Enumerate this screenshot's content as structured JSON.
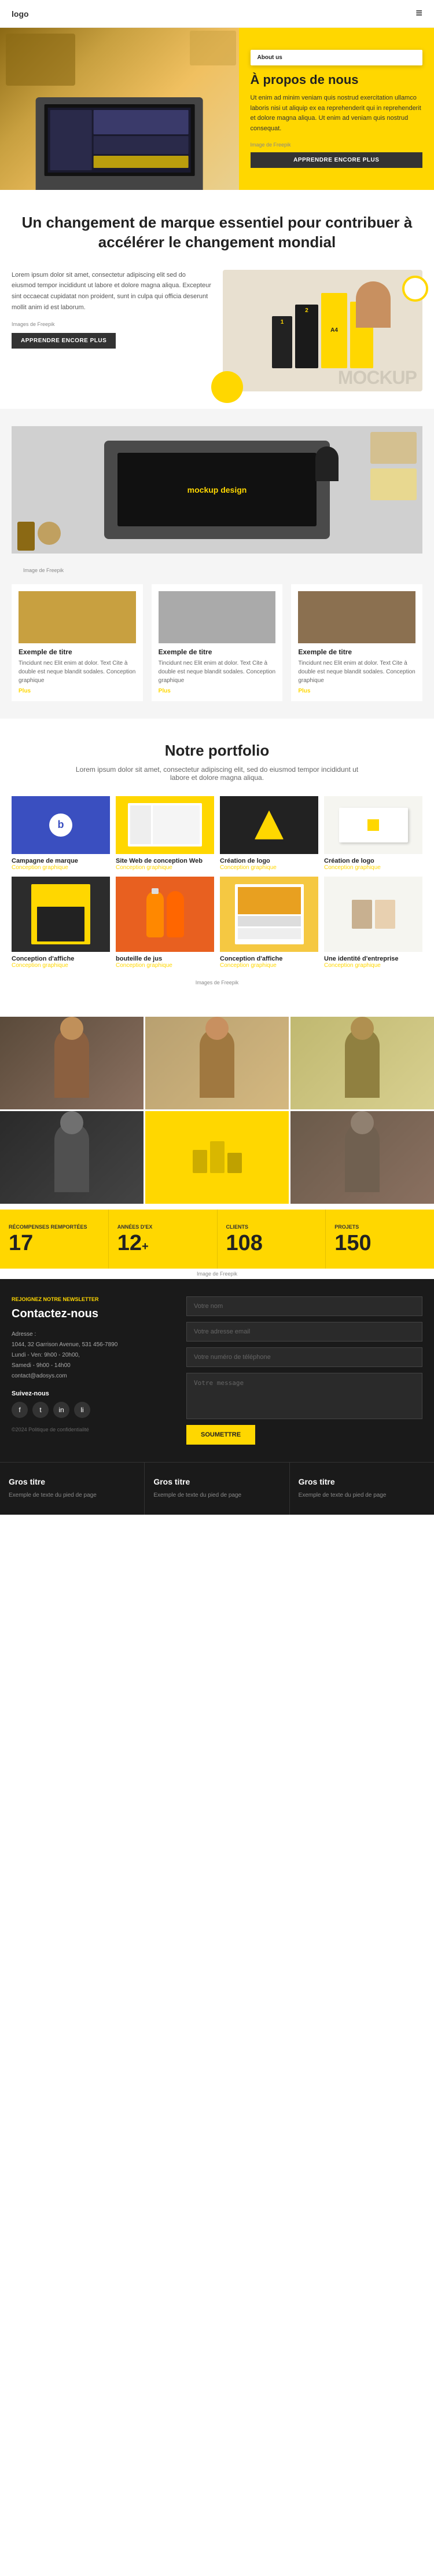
{
  "navbar": {
    "logo": "logo",
    "hamburger_icon": "≡",
    "menu_items": []
  },
  "hero": {
    "about_label": "About us",
    "title": "À propos de nous",
    "description": "Ut enim ad minim veniam quis nostrud exercitation ullamco laboris nisi ut aliquip ex ea reprehenderit qui in reprehenderit et dolore magna aliqua. Ut enim ad veniam quis nostrud consequat.",
    "source_label": "Image de Freepik",
    "btn_label": "APPRENDRE ENCORE PLUS"
  },
  "section2": {
    "heading": "Un changement de marque essentiel pour contribuer à accélérer le changement mondial"
  },
  "mockup": {
    "description": "Lorem ipsum dolor sit amet, consectetur adipiscing elit sed do eiusmod tempor incididunt ut labore et dolore magna aliqua. Excepteur sint occaecat cupidatat non proident, sunt in culpa qui officia deserunt mollit anim id est laborum.",
    "source_label": "Images de Freepik",
    "btn_label": "APPRENDRE ENCORE PLUS",
    "badge_text": "A4",
    "mockup_text": "MOCKUP"
  },
  "services": {
    "mockup_label": "mockup design",
    "source_label": "Image de Freepik",
    "cards": [
      {
        "title": "Exemple de titre",
        "description": "Tincidunt nec Elit enim at dolor. Text Cite à double est neque blandit sodales. Conception graphique",
        "read_more": "Plus"
      },
      {
        "title": "Exemple de titre",
        "description": "Tincidunt nec Elit enim at dolor. Text Cite à double est neque blandit sodales. Conception graphique",
        "read_more": "Plus"
      },
      {
        "title": "Exemple de titre",
        "description": "Tincidunt nec Elit enim at dolor. Text Cite à double est neque blandit sodales. Conception graphique",
        "read_more": "Plus"
      }
    ]
  },
  "portfolio": {
    "title": "Notre portfolio",
    "description": "Lorem ipsum dolor sit amet, consectetur adipiscing elit, sed do eiusmod tempor incididunt ut labore et dolore magna aliqua.",
    "source_label": "Images de Freepik",
    "items": [
      {
        "title": "Campagne de marque",
        "category": "Conception graphique"
      },
      {
        "title": "Site Web de conception Web",
        "category": "Conception graphique"
      },
      {
        "title": "Création de logo",
        "category": "Conception graphique"
      },
      {
        "title": "Création de logo",
        "category": "Conception graphique"
      },
      {
        "title": "Conception d'affiche",
        "category": "Conception graphique"
      },
      {
        "title": "bouteille de jus",
        "category": "Conception graphique"
      },
      {
        "title": "Conception d'affiche",
        "category": "Conception graphique"
      },
      {
        "title": "Une identité d'entreprise",
        "category": "Conception graphique"
      }
    ]
  },
  "stats": {
    "source_label": "Image de Freepik",
    "items": [
      {
        "label": "RÉCOMPENSES REMPORTÉES",
        "value": "17"
      },
      {
        "label": "ANNÉES D'EX",
        "value": "12",
        "plus": "+"
      },
      {
        "label": "CLIENTS",
        "value": "108"
      },
      {
        "label": "PROJETS",
        "value": "150"
      }
    ]
  },
  "contact": {
    "newsletter_label": "REJOIGNEZ NOTRE NEWSLETTER",
    "title": "Contactez-nous",
    "address_label": "Adresse :",
    "address": "1044, 32 Garrison Avenue, 531 456-7890",
    "phone_label": "Lundi - Ven: 9h00 - 20h00,",
    "saturday": "Samedi - 9h00 - 14h00",
    "email": "contact@adosys.com",
    "follow_label": "Suivez-nous",
    "copyright": "©2024 Politique de confidentialité",
    "form": {
      "name_placeholder": "Votre nom",
      "email_placeholder": "Votre adresse email",
      "phone_placeholder": "Votre numéro de téléphone",
      "message_placeholder": "Votre message",
      "submit_label": "SOUMETTRE"
    }
  },
  "footer": {
    "cols": [
      {
        "title": "Gros titre",
        "text": "Exemple de texte du pied de page"
      },
      {
        "title": "Gros titre",
        "text": "Exemple de texte du pied de page"
      },
      {
        "title": "Gros titre",
        "text": "Exemple de texte du pied de page"
      }
    ]
  },
  "colors": {
    "yellow": "#FFD700",
    "dark": "#1a1a1a",
    "text": "#333333"
  }
}
